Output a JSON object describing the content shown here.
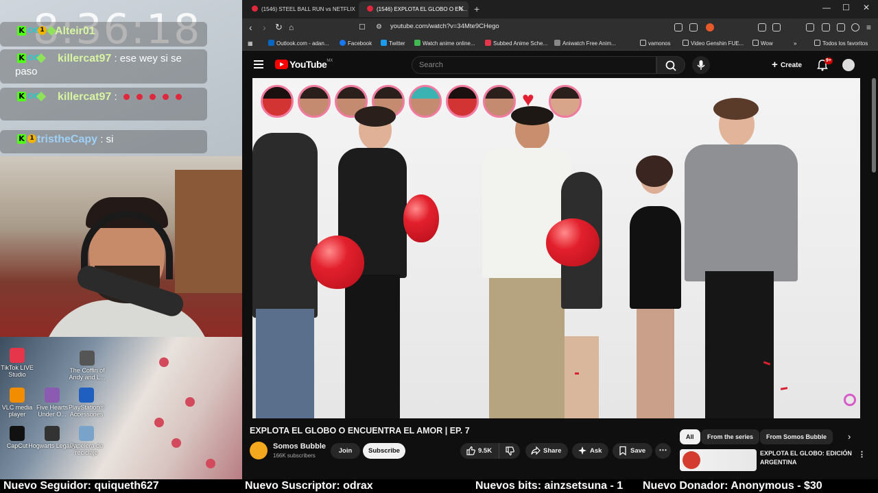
{
  "overlay": {
    "clock": "8:36:18",
    "chat": [
      {
        "user": "Alteir01",
        "text": ""
      },
      {
        "user": "killercat97",
        "text": "ese wey si se paso"
      },
      {
        "user": "killercat97",
        "text": ""
      },
      {
        "user": "tristheCapy",
        "text": "si"
      }
    ],
    "desktop_icons": [
      {
        "label": "TikTok LIVE Studio",
        "color": "#e5364b"
      },
      {
        "label": "The Coffin of Andy and L...",
        "color": "#555555"
      },
      {
        "label": "VLC media player",
        "color": "#f28c00"
      },
      {
        "label": "Five Hearts Under O...",
        "color": "#8a5bb0"
      },
      {
        "label": "PlayStation® Accessories",
        "color": "#1f5fbf"
      },
      {
        "label": "CapCut",
        "color": "#111111"
      },
      {
        "label": "Hogwarts Legacy",
        "color": "#333333"
      },
      {
        "label": "Papelera de reciclaje",
        "color": "#7aa3c9"
      }
    ]
  },
  "browser": {
    "tabs": [
      {
        "title": "(1546) STEEL BALL RUN vs NETFLIX ¿",
        "active": false
      },
      {
        "title": "(1546) EXPLOTA EL GLOBO O EN...",
        "active": true
      }
    ],
    "url": "youtube.com/watch?v=34Mte9CHego",
    "bookmarks": [
      {
        "label": "Outlook.com - adan...",
        "color": "#0a66c2"
      },
      {
        "label": "Facebook",
        "color": "#1877f2"
      },
      {
        "label": "Twitter",
        "color": "#1d9bf0"
      },
      {
        "label": "Watch anime online...",
        "color": "#3fb950"
      },
      {
        "label": "Subbed Anime Sche...",
        "color": "#e5364b"
      },
      {
        "label": "Aniwatch Free Anim...",
        "color": "#888888"
      },
      {
        "label": "vamonos",
        "color": "folder"
      },
      {
        "label": "Video Genshin FUE...",
        "color": "folder"
      },
      {
        "label": "Wow",
        "color": "folder"
      }
    ],
    "all_bookmarks": "Todos los favoritos"
  },
  "youtube": {
    "logo": "YouTube",
    "region": "MX",
    "search_placeholder": "Search",
    "create_label": "Create",
    "notif_count": "9+",
    "video": {
      "title": "EXPLOTA EL GLOBO O ENCUENTRA EL AMOR | EP. 7",
      "channel": "Somos Bubble",
      "subscribers": "166K subscribers",
      "join": "Join",
      "subscribe": "Subscribe",
      "likes": "9.5K",
      "share": "Share",
      "ask": "Ask",
      "save": "Save"
    },
    "chips": [
      {
        "label": "All",
        "active": true
      },
      {
        "label": "From the series",
        "active": false
      },
      {
        "label": "From Somos Bubble",
        "active": false
      }
    ],
    "recommended": {
      "title": "EXPLOTA EL GLOBO: EDICIÓN ARGENTINA"
    }
  },
  "ticker": {
    "follower": "Nuevo Seguidor: quiqueth627",
    "subscriber": "Nuevo Suscriptor: odrax",
    "bits": "Nuevos bits: ainzsetsuna - 1",
    "donor": "Nuevo Donador: Anonymous - $30"
  }
}
